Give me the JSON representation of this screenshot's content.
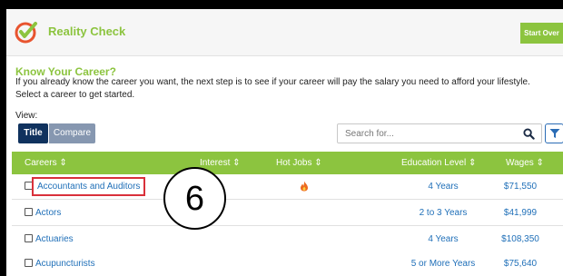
{
  "app": {
    "title": "Reality Check",
    "start_over_label": "Start Over",
    "accent_color": "#8cc43f"
  },
  "intro": {
    "heading": "Know Your Career?",
    "text": "If you already know the career you want, the next step is to see if your career will pay the salary you need to afford your lifestyle. Select a career to get started."
  },
  "view": {
    "label": "View:",
    "title_label": "Title",
    "compare_label": "Compare"
  },
  "search": {
    "placeholder": "Search for..."
  },
  "table": {
    "headers": {
      "careers": "Careers ⇕",
      "interest": "Interest ⇕",
      "hot_jobs": "Hot Jobs ⇕",
      "education": "Education Level ⇕",
      "wages": "Wages ⇕"
    },
    "rows": [
      {
        "career": "Accountants and Auditors",
        "hot": true,
        "education": "4 Years",
        "wage": "$71,550"
      },
      {
        "career": "Actors",
        "hot": false,
        "education": "2 to 3 Years",
        "wage": "$41,999"
      },
      {
        "career": "Actuaries",
        "hot": false,
        "education": "4 Years",
        "wage": "$108,350"
      },
      {
        "career": "Acupuncturists",
        "hot": false,
        "education": "5 or More Years",
        "wage": "$75,640"
      }
    ]
  },
  "annotation": {
    "callout_number": "6"
  },
  "icons": {
    "logo": "checkmark-circle-icon",
    "search": "search-icon",
    "filter": "filter-icon",
    "hot": "fire-icon"
  }
}
